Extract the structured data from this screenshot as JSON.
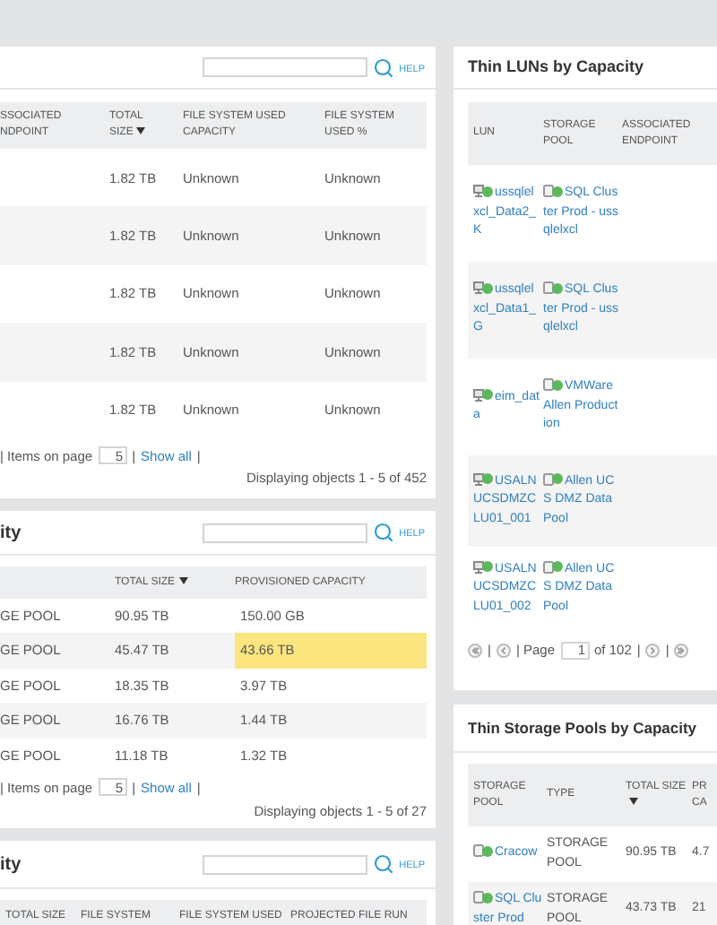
{
  "file_systems_panel": {
    "help": "HELP",
    "columns": [
      {
        "label": "SSOCIATED NDPOINT",
        "sorted": false
      },
      {
        "label": "TOTAL SIZE",
        "sorted": true
      },
      {
        "label": "FILE SYSTEM USED CAPACITY",
        "sorted": false
      },
      {
        "label": "FILE SYSTEM USED %",
        "sorted": false
      }
    ],
    "rows": [
      [
        "",
        "1.82 TB",
        "Unknown",
        "Unknown"
      ],
      [
        "",
        "1.82 TB",
        "Unknown",
        "Unknown"
      ],
      [
        "",
        "1.82 TB",
        "Unknown",
        "Unknown"
      ],
      [
        "",
        "1.82 TB",
        "Unknown",
        "Unknown"
      ],
      [
        "",
        "1.82 TB",
        "Unknown",
        "Unknown"
      ]
    ],
    "pager": {
      "items_label": "| Items on page",
      "items_value": "5",
      "show_all": "Show all",
      "separator": "|"
    },
    "summary": "Displaying objects 1 - 5 of 452"
  },
  "pools_panel": {
    "title": "ity",
    "help": "HELP",
    "columns": [
      {
        "label": "TOTAL SIZE",
        "sorted": true
      },
      {
        "label": "PROVISIONED CAPACITY",
        "sorted": false
      }
    ],
    "rows": [
      {
        "pool": "GE POOL",
        "size": "90.95 TB",
        "provisioned": "150.00 GB",
        "highlighted": false
      },
      {
        "pool": "GE POOL",
        "size": "45.47 TB",
        "provisioned": "43.66 TB",
        "highlighted": true
      },
      {
        "pool": "GE POOL",
        "size": "18.35 TB",
        "provisioned": "3.97 TB",
        "highlighted": false
      },
      {
        "pool": "GE POOL",
        "size": "16.76 TB",
        "provisioned": "1.44 TB",
        "highlighted": false
      },
      {
        "pool": "GE POOL",
        "size": "11.18 TB",
        "provisioned": "1.32 TB",
        "highlighted": false
      }
    ],
    "pager": {
      "items_label": "| Items on page",
      "items_value": "5",
      "show_all": "Show all",
      "separator": "|"
    },
    "summary": "Displaying objects 1 - 5 of 27"
  },
  "third_panel": {
    "title": "ity",
    "help": "HELP",
    "columns": [
      "TOTAL SIZE",
      "FILE SYSTEM",
      "FILE SYSTEM USED",
      "PROJECTED FILE RUN"
    ]
  },
  "thin_luns_panel": {
    "title": "Thin LUNs by Capacity",
    "columns": [
      "LUN",
      "STORAGE POOL",
      "ASSOCIATED ENDPOINT"
    ],
    "rows": [
      {
        "lun": {
          "name": "ussqlelxcl_Data2_K",
          "color": "#5cb85c"
        },
        "pool": {
          "name": "SQL Cluster Prod - ussqlelxcl",
          "color": "#5cb85c"
        }
      },
      {
        "lun": {
          "name": "ussqlelxcl_Data1_G",
          "color": "#5cb85c"
        },
        "pool": {
          "name": "SQL Cluster Prod - ussqlelxcl",
          "color": "#5cb85c"
        }
      },
      {
        "lun": {
          "name": "eim_data",
          "color": "#5cb85c"
        },
        "pool": {
          "name": "VMWare Allen Production",
          "color": "#5cb85c"
        }
      },
      {
        "lun": {
          "name": "USALNUCSDMZCLU01_001",
          "color": "#5cb85c"
        },
        "pool": {
          "name": "Allen UCS DMZ Data Pool",
          "color": "#5cb85c"
        }
      },
      {
        "lun": {
          "name": "USALNUCSDMZCLU01_002",
          "color": "#5cb85c"
        },
        "pool": {
          "name": "Allen UCS DMZ Data Pool",
          "color": "#5cb85c"
        }
      }
    ],
    "pager": {
      "page_label": "| Page",
      "page_value": "1",
      "of": "of 102",
      "separator": "|"
    }
  },
  "thin_pools_panel": {
    "title": "Thin Storage Pools by Capacity",
    "columns": [
      {
        "label": "STORAGE POOL",
        "sorted": false
      },
      {
        "label": "TYPE",
        "sorted": false
      },
      {
        "label": "TOTAL SIZE",
        "sorted": true
      },
      {
        "label": "PR CA",
        "sorted": false
      }
    ],
    "rows": [
      {
        "pool": "Cracow",
        "color": "#5cb85c",
        "type": "STORAGE POOL",
        "size": "90.95 TB",
        "column_4": "4.7"
      },
      {
        "pool": "SQL Cluster Prod",
        "color": "#5cb85c",
        "type": "STORAGE POOL",
        "size": "43.73 TB",
        "column_4": "21"
      }
    ]
  }
}
